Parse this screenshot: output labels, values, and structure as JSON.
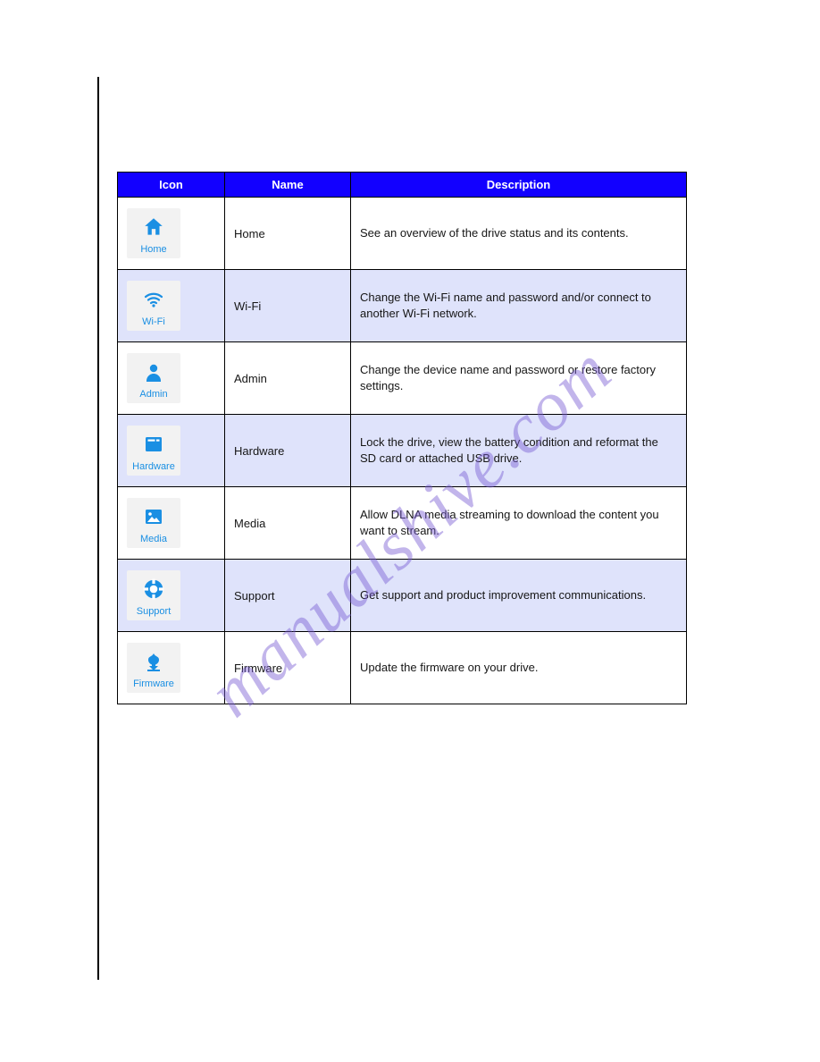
{
  "watermark": "manualshive.com",
  "table": {
    "headers": [
      "Icon",
      "Name",
      "Description"
    ],
    "rows": [
      {
        "icon_name": "home-icon",
        "icon_label": "Home",
        "name": "Home",
        "desc": "See an overview of the drive status and its contents.",
        "svg": "<svg width='26' height='26' viewBox='0 0 24 24'><path fill='#1a8fe3' d='M12 3l9 8h-3v9h-4v-6h-4v6H6v-9H3z'/></svg>"
      },
      {
        "icon_name": "wifi-icon",
        "icon_label": "Wi-Fi",
        "name": "Wi-Fi",
        "desc": "Change the Wi-Fi name and password and/or connect to another Wi-Fi network.",
        "svg": "<svg width='26' height='24' viewBox='0 0 24 24'><path fill='none' stroke='#1a8fe3' stroke-width='2.2' stroke-linecap='round' d='M3 9a14 14 0 0 1 18 0'/><path fill='none' stroke='#1a8fe3' stroke-width='2.2' stroke-linecap='round' d='M6 12.5a9.5 9.5 0 0 1 12 0'/><path fill='none' stroke='#1a8fe3' stroke-width='2.2' stroke-linecap='round' d='M9 16a5 5 0 0 1 6 0'/><circle cx='12' cy='19' r='1.6' fill='#1a8fe3'/></svg>"
      },
      {
        "icon_name": "admin-icon",
        "icon_label": "Admin",
        "name": "Admin",
        "desc": "Change the device name and password or restore factory settings.",
        "svg": "<svg width='24' height='26' viewBox='0 0 24 24'><circle cx='12' cy='8' r='4.2' fill='#1a8fe3'/><path fill='#1a8fe3' d='M4 22c0-4.4 3.6-8 8-8s8 3.6 8 8v1H4z'/></svg>"
      },
      {
        "icon_name": "hardware-icon",
        "icon_label": "Hardware",
        "name": "Hardware",
        "desc": "Lock the drive, view the battery condition and reformat the SD card or attached USB drive.",
        "svg": "<svg width='26' height='24' viewBox='0 0 24 24'><rect x='3' y='4' width='18' height='16' rx='1.5' fill='#1a8fe3'/><rect x='5.5' y='6.5' width='8' height='2.2' fill='#ffffff'/><rect x='15' y='6.5' width='3.5' height='2.2' fill='#ffffff'/></svg>"
      },
      {
        "icon_name": "media-icon",
        "icon_label": "Media",
        "name": "Media",
        "desc": "Allow DLNA media streaming to download the content you want to stream.",
        "svg": "<svg width='26' height='24' viewBox='0 0 24 24'><rect x='3' y='4' width='18' height='16' rx='1.5' fill='#1a8fe3'/><circle cx='8' cy='9' r='1.8' fill='#ffffff'/><path fill='#ffffff' d='M5 18l5-6 3 3 2-2 4 5z'/></svg>"
      },
      {
        "icon_name": "support-icon",
        "icon_label": "Support",
        "name": "Support",
        "desc": "Get support and product improvement communications.",
        "svg": "<svg width='26' height='26' viewBox='0 0 24 24'><circle cx='12' cy='12' r='9.5' fill='#1a8fe3'/><circle cx='12' cy='12' r='4' fill='#ffffff'/><rect x='10.5' y='1.5' width='3' height='5' fill='#ffffff'/><rect x='10.5' y='17.5' width='3' height='5' fill='#ffffff'/><rect x='1.5' y='10.5' width='5' height='3' fill='#ffffff'/><rect x='17.5' y='10.5' width='5' height='3' fill='#ffffff'/></svg>"
      },
      {
        "icon_name": "firmware-icon",
        "icon_label": "Firmware",
        "name": "Firmware",
        "desc": "Update the firmware on your drive.",
        "svg": "<svg width='24' height='26' viewBox='0 0 24 24'><path fill='#1a8fe3' d='M12 3c2 4 6 3 6 7 0 2.6-1.6 4.6-4 5.5V17l3 0-5 5-5-5 3 0v-1.5c-2.4-.9-4-2.9-4-5.5 0-4 4-3 6-7z'/><rect x='5' y='21' width='14' height='2' fill='#1a8fe3'/></svg>"
      }
    ]
  }
}
